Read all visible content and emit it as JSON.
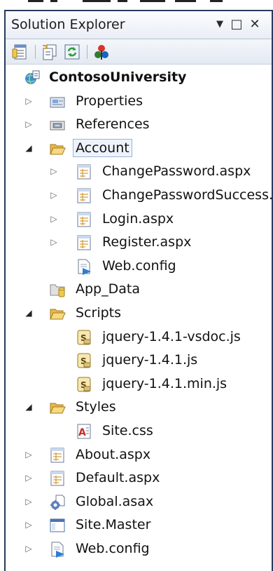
{
  "panel": {
    "title": "Solution Explorer",
    "controls": {
      "dropdown": "▼",
      "maximize": "□",
      "close": "✕"
    }
  },
  "toolbar": {
    "buttons": [
      {
        "icon": "properties-icon"
      },
      {
        "icon": "show-all-files-icon"
      },
      {
        "icon": "refresh-icon"
      },
      {
        "icon": "class-view-icon"
      }
    ]
  },
  "tree": {
    "root": "ContosoUniversity",
    "items": [
      {
        "label": "Properties",
        "state": "collapsed",
        "icon": "properties-folder-icon"
      },
      {
        "label": "References",
        "state": "collapsed",
        "icon": "references-icon"
      },
      {
        "label": "Account",
        "state": "expanded",
        "icon": "folder-open-icon"
      },
      {
        "label": "ChangePassword.aspx",
        "state": "collapsed",
        "icon": "aspx-page-icon"
      },
      {
        "label": "ChangePasswordSuccess.aspx",
        "state": "collapsed",
        "icon": "aspx-page-icon"
      },
      {
        "label": "Login.aspx",
        "state": "collapsed",
        "icon": "aspx-page-icon"
      },
      {
        "label": "Register.aspx",
        "state": "collapsed",
        "icon": "aspx-page-icon"
      },
      {
        "label": "Web.config",
        "state": "none",
        "icon": "config-file-icon"
      },
      {
        "label": "App_Data",
        "state": "none",
        "icon": "app-data-folder-icon"
      },
      {
        "label": "Scripts",
        "state": "expanded",
        "icon": "folder-open-icon"
      },
      {
        "label": "jquery-1.4.1-vsdoc.js",
        "state": "none",
        "icon": "script-file-icon"
      },
      {
        "label": "jquery-1.4.1.js",
        "state": "none",
        "icon": "script-file-icon"
      },
      {
        "label": "jquery-1.4.1.min.js",
        "state": "none",
        "icon": "script-file-icon"
      },
      {
        "label": "Styles",
        "state": "expanded",
        "icon": "folder-open-icon"
      },
      {
        "label": "Site.css",
        "state": "none",
        "icon": "css-file-icon"
      },
      {
        "label": "About.aspx",
        "state": "collapsed",
        "icon": "aspx-page-icon"
      },
      {
        "label": "Default.aspx",
        "state": "collapsed",
        "icon": "aspx-page-icon"
      },
      {
        "label": "Global.asax",
        "state": "collapsed",
        "icon": "global-asax-icon"
      },
      {
        "label": "Site.Master",
        "state": "collapsed",
        "icon": "master-page-icon"
      },
      {
        "label": "Web.config",
        "state": "collapsed",
        "icon": "config-file-icon"
      }
    ]
  }
}
